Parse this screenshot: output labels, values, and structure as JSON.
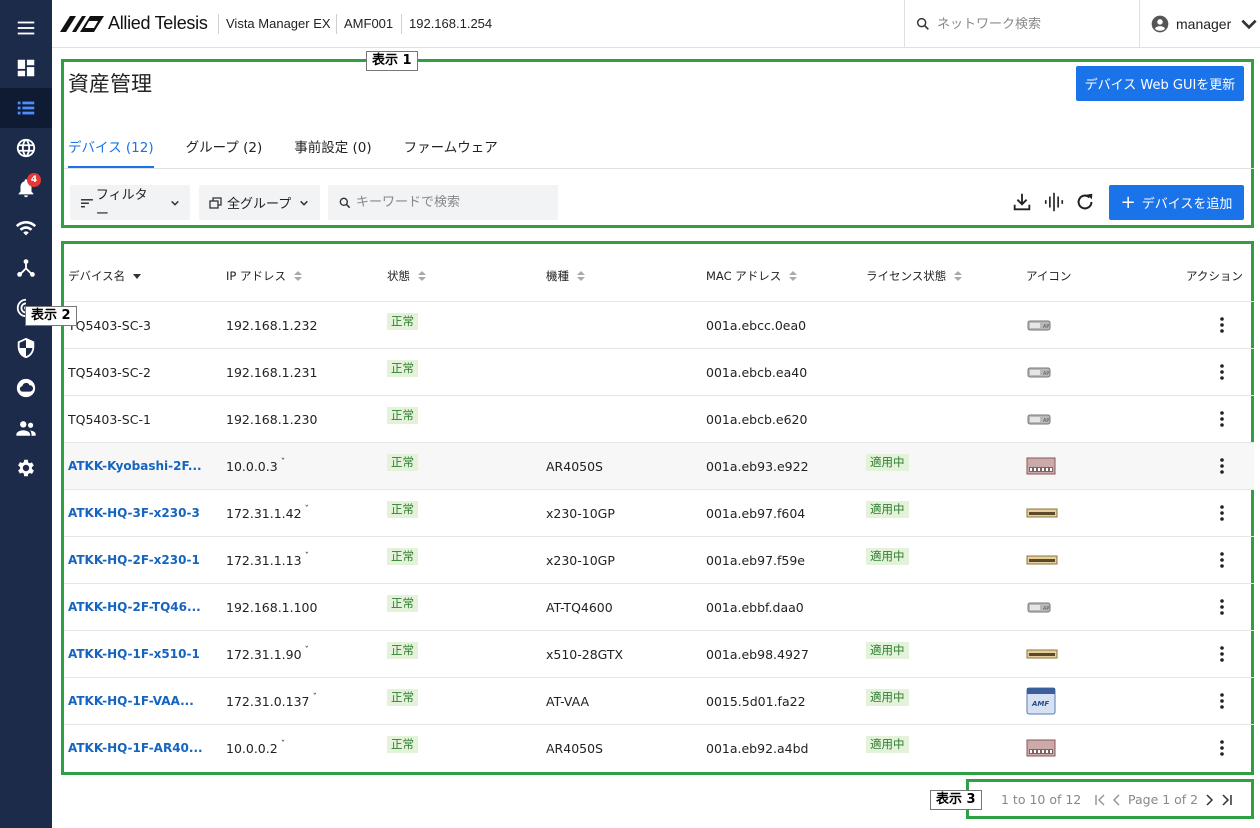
{
  "header": {
    "logo_text": "Allied Telesis",
    "product": "Vista Manager EX",
    "node": "AMF001",
    "ip": "192.168.1.254",
    "search_placeholder": "ネットワーク検索",
    "user": "manager"
  },
  "sidebar": {
    "items": [
      {
        "icon": "menu-icon"
      },
      {
        "icon": "dashboard-icon"
      },
      {
        "icon": "list-icon",
        "active": true
      },
      {
        "icon": "globe-icon"
      },
      {
        "icon": "bell-icon",
        "badge": "4"
      },
      {
        "icon": "wifi-icon"
      },
      {
        "icon": "topology-icon"
      },
      {
        "icon": "target-icon"
      },
      {
        "icon": "shield-icon"
      },
      {
        "icon": "cloud-icon"
      },
      {
        "icon": "users-icon"
      },
      {
        "icon": "gear-icon"
      }
    ]
  },
  "annotations": {
    "label1": "表示 1",
    "label2": "表示 2",
    "label3": "表示 3",
    "box_color": "#2ea043"
  },
  "page": {
    "title": "資産管理",
    "update_button": "デバイス Web GUIを更新",
    "tabs": [
      "デバイス (12)",
      "グループ (2)",
      "事前設定 (0)",
      "ファームウェア"
    ],
    "filter_button": "フィルター",
    "group_button": "全グループ",
    "search_placeholder": "キーワードで検索",
    "add_button": "デバイスを追加"
  },
  "table": {
    "columns": [
      "デバイス名",
      "IP アドレス",
      "状態",
      "機種",
      "MAC アドレス",
      "ライセンス状態",
      "アイコン",
      "アクション"
    ],
    "rows": [
      {
        "name": "TQ5403-SC-3",
        "link": false,
        "ip": "192.168.1.232",
        "has_chev": false,
        "status": "正常",
        "model": "",
        "mac": "001a.ebcc.0ea0",
        "license": "",
        "icon": "ap"
      },
      {
        "name": "TQ5403-SC-2",
        "link": false,
        "ip": "192.168.1.231",
        "has_chev": false,
        "status": "正常",
        "model": "",
        "mac": "001a.ebcb.ea40",
        "license": "",
        "icon": "ap"
      },
      {
        "name": "TQ5403-SC-1",
        "link": false,
        "ip": "192.168.1.230",
        "has_chev": false,
        "status": "正常",
        "model": "",
        "mac": "001a.ebcb.e620",
        "license": "",
        "icon": "ap"
      },
      {
        "name": "ATKK-Kyobashi-2F...",
        "link": true,
        "ip": "10.0.0.3",
        "has_chev": true,
        "status": "正常",
        "model": "AR4050S",
        "mac": "001a.eb93.e922",
        "license": "適用中",
        "icon": "router"
      },
      {
        "name": "ATKK-HQ-3F-x230-3",
        "link": true,
        "ip": "172.31.1.42",
        "has_chev": true,
        "status": "正常",
        "model": "x230-10GP",
        "mac": "001a.eb97.f604",
        "license": "適用中",
        "icon": "switch"
      },
      {
        "name": "ATKK-HQ-2F-x230-1",
        "link": true,
        "ip": "172.31.1.13",
        "has_chev": true,
        "status": "正常",
        "model": "x230-10GP",
        "mac": "001a.eb97.f59e",
        "license": "適用中",
        "icon": "switch"
      },
      {
        "name": "ATKK-HQ-2F-TQ46...",
        "link": true,
        "ip": "192.168.1.100",
        "has_chev": false,
        "status": "正常",
        "model": "AT-TQ4600",
        "mac": "001a.ebbf.daa0",
        "license": "",
        "icon": "ap"
      },
      {
        "name": "ATKK-HQ-1F-x510-1",
        "link": true,
        "ip": "172.31.1.90",
        "has_chev": true,
        "status": "正常",
        "model": "x510-28GTX",
        "mac": "001a.eb98.4927",
        "license": "適用中",
        "icon": "switch"
      },
      {
        "name": "ATKK-HQ-1F-VAA...",
        "link": true,
        "ip": "172.31.0.137",
        "has_chev": true,
        "status": "正常",
        "model": "AT-VAA",
        "mac": "0015.5d01.fa22",
        "license": "適用中",
        "icon": "amf"
      },
      {
        "name": "ATKK-HQ-1F-AR40...",
        "link": true,
        "ip": "10.0.0.2",
        "has_chev": true,
        "status": "正常",
        "model": "AR4050S",
        "mac": "001a.eb92.a4bd",
        "license": "適用中",
        "icon": "router"
      }
    ]
  },
  "pagination": {
    "range": "1 to 10 of 12",
    "page_label": "Page 1 of 2"
  }
}
